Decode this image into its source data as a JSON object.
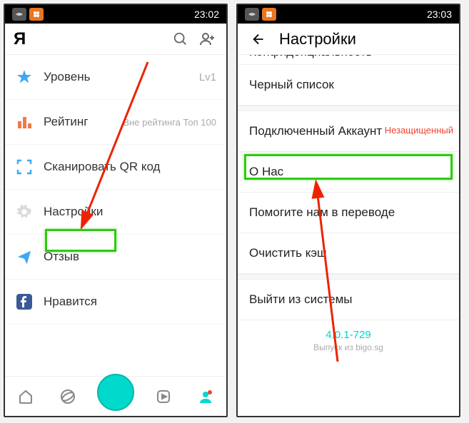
{
  "left": {
    "clock": "23:02",
    "header_title": "Я",
    "menu": [
      {
        "icon": "star",
        "label": "Уровень",
        "value": "Lv1",
        "color": "#3fa8f4"
      },
      {
        "icon": "bars",
        "label": "Рейтинг",
        "value": "Вне рейтинга Топ 100",
        "color": "#ee7b4b"
      },
      {
        "icon": "qr",
        "label": "Сканировать QR код",
        "value": "",
        "color": "#3fa8f4"
      },
      {
        "icon": "gear",
        "label": "Настройки",
        "value": "",
        "color": "#999"
      },
      {
        "icon": "plane",
        "label": "Отзыв",
        "value": "",
        "color": "#3fa8f4"
      },
      {
        "icon": "fb",
        "label": "Нравится",
        "value": "",
        "color": "#3b5998"
      }
    ]
  },
  "right": {
    "clock": "23:03",
    "header_title": "Настройки",
    "cut_top": "Конфиденциальность",
    "items": [
      "Черный список",
      "Подключенный Аккаунт",
      "О Нас",
      "Помогите нам в переводе",
      "Очистить кэш",
      "Выйти из системы"
    ],
    "red_overlay": "Незащищенный",
    "version": "4.0.1-729",
    "version_sub": "Выпуск из bigo.sg"
  }
}
